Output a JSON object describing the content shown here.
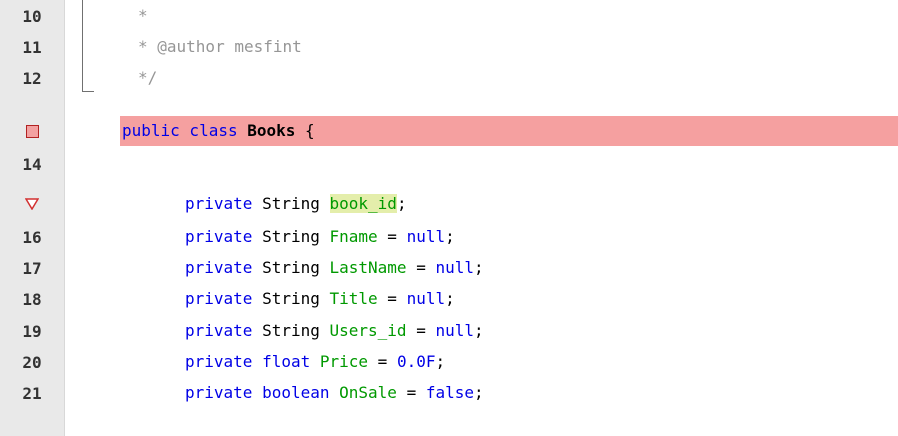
{
  "editor": {
    "lines": [
      {
        "num": "10",
        "comment": "*"
      },
      {
        "num": "11",
        "comment": "* @author mesfint"
      },
      {
        "num": "12",
        "comment": "*/"
      },
      {
        "num": "",
        "kw1": "public class",
        "classname": "Books",
        "brace": " {"
      },
      {
        "num": "14"
      },
      {
        "num": "",
        "kw": "private",
        "type": " String ",
        "field": "book_id",
        "tail": ";"
      },
      {
        "num": "16",
        "kw": "private",
        "type": " String ",
        "field": "Fname",
        "op": " = ",
        "val": "null",
        "tail": ";"
      },
      {
        "num": "17",
        "kw": "private",
        "type": " String ",
        "field": "LastName",
        "op": " = ",
        "val": "null",
        "tail": ";"
      },
      {
        "num": "18",
        "kw": "private",
        "type": " String ",
        "field": "Title",
        "op": " = ",
        "val": "null",
        "tail": ";"
      },
      {
        "num": "19",
        "kw": "private",
        "type": " String ",
        "field": "Users_id",
        "op": " = ",
        "val": "null",
        "tail": ";"
      },
      {
        "num": "20",
        "kw": "private",
        "type": " float ",
        "field": "Price",
        "op": " = ",
        "val": "0.0F",
        "tail": ";"
      },
      {
        "num": "21",
        "kw": "private",
        "type": " boolean ",
        "field": "OnSale",
        "op": " = ",
        "val": "false",
        "tail": ";"
      }
    ],
    "markers": {
      "line_13": "breakpoint-box-icon",
      "line_15": "warning-triangle-icon"
    },
    "colors": {
      "keyword": "#0000e6",
      "field": "#009900",
      "comment": "#969696",
      "highlight_line": "#f5a0a0",
      "occurrence_mark": "#e4eeab",
      "gutter": "#e9e9e9"
    }
  }
}
